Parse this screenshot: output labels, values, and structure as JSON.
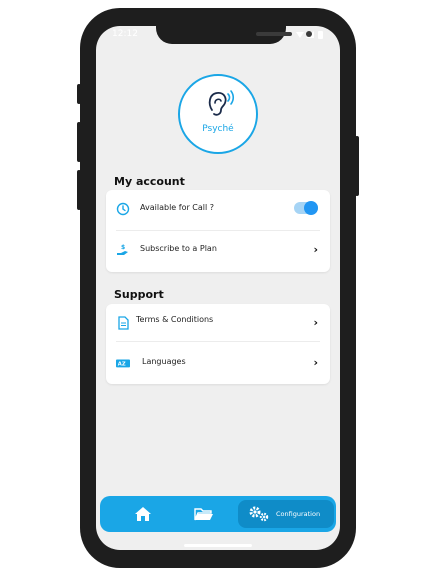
{
  "status_bar": {
    "time": "12:12"
  },
  "app": {
    "logo_text": "Psyché",
    "logo_icon": "ear-sound-icon"
  },
  "my_account": {
    "title": "My account",
    "items": [
      {
        "label": "Available for Call ?",
        "icon": "clock-icon",
        "toggle_on": true
      },
      {
        "label": "Subscribe to a Plan",
        "icon": "money-hand-icon"
      }
    ]
  },
  "support": {
    "title": "Support",
    "items": [
      {
        "label": "Terms & Conditions",
        "icon": "document-icon"
      },
      {
        "label": "Languages",
        "icon": "translate-icon"
      }
    ]
  },
  "bottom_nav": {
    "items": [
      {
        "icon": "home-icon"
      },
      {
        "icon": "folder-icon"
      },
      {
        "icon": "gears-icon",
        "label": "Configuration",
        "active": true
      }
    ]
  },
  "colors": {
    "accent": "#1aa6e6",
    "background": "#efefef",
    "toggle_on": "#2196f3"
  }
}
